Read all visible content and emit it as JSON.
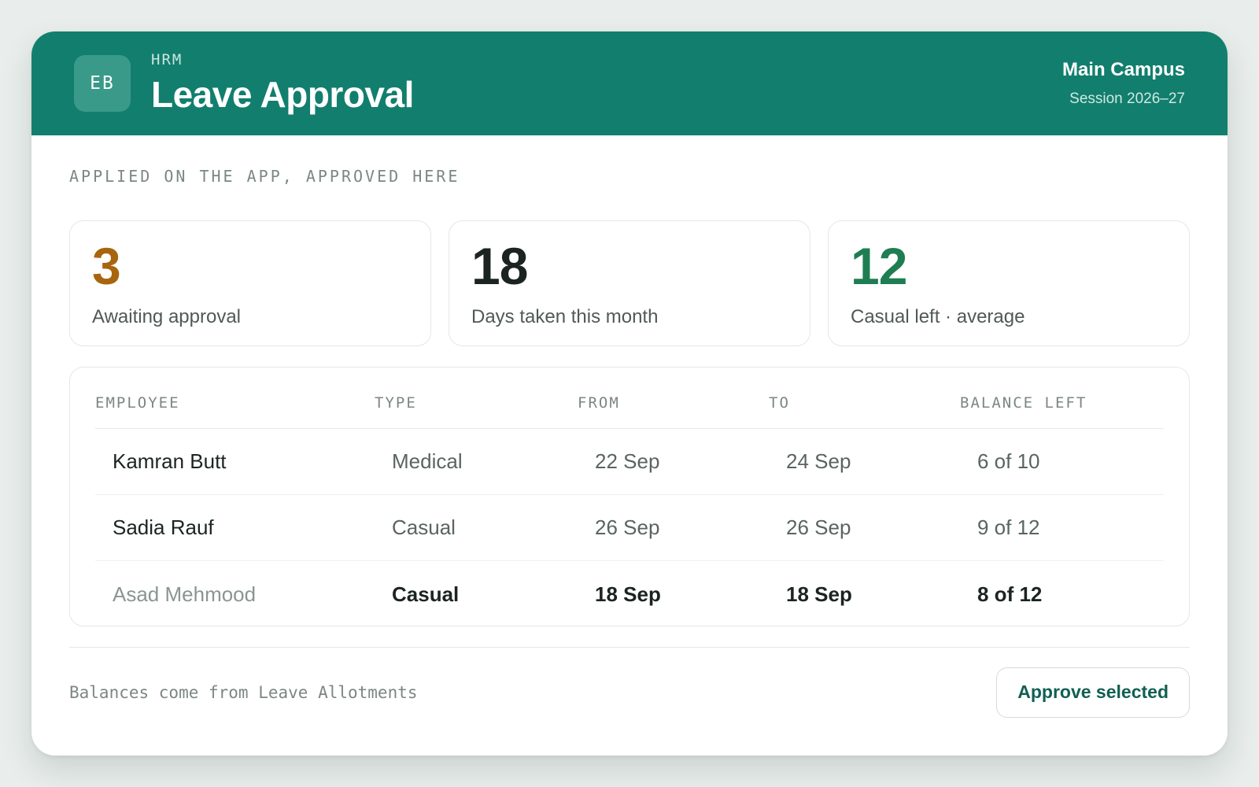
{
  "header": {
    "avatar": "EB",
    "eyebrow": "HRM",
    "title": "Leave Approval",
    "campus": "Main Campus",
    "session": "Session 2026–27"
  },
  "section_label": "APPLIED ON THE APP, APPROVED HERE",
  "stats": [
    {
      "value": "3",
      "label": "Awaiting approval",
      "color": "#a8650f"
    },
    {
      "value": "18",
      "label": "Days taken this month",
      "color": "#1c2421"
    },
    {
      "value": "12",
      "label": "Casual left · average",
      "color": "#1f7d52"
    }
  ],
  "table": {
    "columns": [
      "EMPLOYEE",
      "TYPE",
      "FROM",
      "TO",
      "BALANCE LEFT"
    ],
    "rows": [
      {
        "employee": "Kamran Butt",
        "type": "Medical",
        "from": "22 Sep",
        "to": "24 Sep",
        "balance": "6 of 10"
      },
      {
        "employee": "Sadia Rauf",
        "type": "Casual",
        "from": "26 Sep",
        "to": "26 Sep",
        "balance": "9 of 12"
      },
      {
        "employee": "Asad Mehmood",
        "type": "Casual",
        "from": "18 Sep",
        "to": "18 Sep",
        "balance": "8 of 12"
      }
    ]
  },
  "footer": {
    "note": "Balances come from Leave Allotments",
    "approve_label": "Approve selected"
  },
  "colors": {
    "brand": "#127e6e",
    "pending": "#a8650f",
    "positive": "#1f7d52"
  }
}
